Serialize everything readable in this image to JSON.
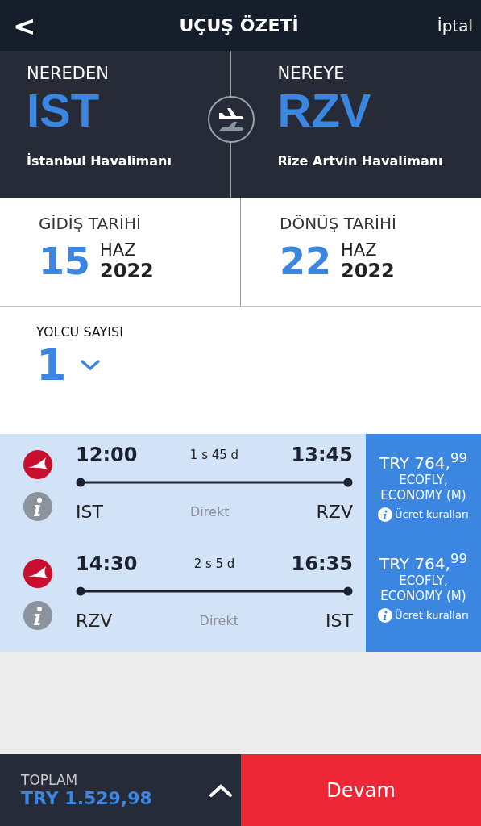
{
  "header": {
    "back": "<",
    "title": "UÇUŞ ÖZETİ",
    "cancel": "İptal"
  },
  "route": {
    "from": {
      "label": "NEREDEN",
      "code": "IST",
      "airport": "İstanbul Havalimanı"
    },
    "to": {
      "label": "NEREYE",
      "code": "RZV",
      "airport": "Rize Artvin Havalimanı"
    }
  },
  "dates": [
    {
      "label": "GİDİŞ TARİHİ",
      "day": "15",
      "month": "HAZ",
      "year": "2022"
    },
    {
      "label": "DÖNÜŞ TARİHİ",
      "day": "22",
      "month": "HAZ",
      "year": "2022"
    }
  ],
  "passengers": {
    "label": "YOLCU SAYISI",
    "value": "1"
  },
  "flights": [
    {
      "dep_time": "12:00",
      "duration": "1 s 45 d",
      "arr_time": "13:45",
      "from": "IST",
      "stops": "Direkt",
      "to": "RZV",
      "price": "TRY 764,$^{99}$",
      "fare": "ECOFLY,",
      "cabin": "ECONOMY (M)",
      "rules": "Ücret kuralları"
    },
    {
      "dep_time": "14:30",
      "duration": "2 s 5 d",
      "arr_time": "16:35",
      "from": "RZV",
      "stops": "Direkt",
      "to": "IST",
      "price": "TRY 764,$^{99}$",
      "fare": "ECOFLY,",
      "cabin": "ECONOMY (M)",
      "rules": "Ücret kuralları"
    }
  ],
  "footer": {
    "total_label": "TOPLAM",
    "total": "TRY 1.529,98",
    "continue": "Devam"
  }
}
